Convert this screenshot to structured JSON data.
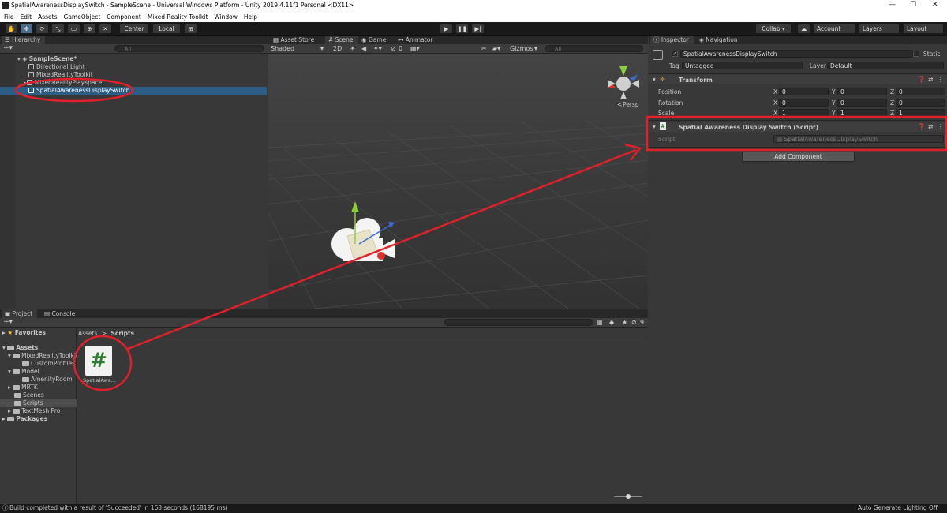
{
  "window": {
    "title": "SpatialAwarenessDisplaySwitch - SampleScene - Universal Windows Platform - Unity 2019.4.11f1 Personal <DX11>",
    "minimize": "—",
    "maximize": "☐",
    "close": "✕"
  },
  "menu": [
    "File",
    "Edit",
    "Assets",
    "GameObject",
    "Component",
    "Mixed Reality Toolkit",
    "Window",
    "Help"
  ],
  "toolbar": {
    "center": "Center",
    "local": "Local",
    "collab": "Collab ▾",
    "account": "Account",
    "layers": "Layers",
    "layout": "Layout"
  },
  "hierarchy": {
    "tab": "Hierarchy",
    "search_placeholder": "All",
    "scene": "SampleScene*",
    "items": [
      "Directional Light",
      "MixedRealityToolkit",
      "MixedRealityPlayspace",
      "SpatialAwarenessDisplaySwitch"
    ]
  },
  "scene_tabs": [
    "Asset Store",
    "Scene",
    "Game",
    "Animator"
  ],
  "scene": {
    "shading": "Shaded",
    "mode_2d": "2D",
    "fx_count": "0",
    "gizmos": "Gizmos",
    "search_placeholder": "All",
    "persp": "Persp"
  },
  "project": {
    "tabs": [
      "Project",
      "Console"
    ],
    "breadcrumb": [
      "Assets",
      "Scripts"
    ],
    "favorites": "Favorites",
    "tree": [
      {
        "label": "Assets",
        "bold": true
      },
      {
        "label": "MixedRealityToolkit.Generated",
        "bold": false
      },
      {
        "label": "CustomProfiles",
        "bold": false
      },
      {
        "label": "Model",
        "bold": false
      },
      {
        "label": "AmenityRoom",
        "bold": false
      },
      {
        "label": "MRTK",
        "bold": false
      },
      {
        "label": "Scenes",
        "bold": false
      },
      {
        "label": "Scripts",
        "bold": false
      },
      {
        "label": "TextMesh Pro",
        "bold": false
      },
      {
        "label": "Packages",
        "bold": true
      }
    ],
    "asset_label": "SpatialAwa...",
    "asset_icon": "#",
    "hidden_count": "9"
  },
  "inspector": {
    "tabs": [
      "Inspector",
      "Navigation"
    ],
    "object_name": "SpatialAwarenessDisplaySwitch",
    "static_label": "Static",
    "tag_label": "Tag",
    "tag_value": "Untagged",
    "layer_label": "Layer",
    "layer_value": "Default",
    "transform": {
      "title": "Transform",
      "rows": [
        {
          "label": "Position",
          "x": "0",
          "y": "0",
          "z": "0"
        },
        {
          "label": "Rotation",
          "x": "0",
          "y": "0",
          "z": "0"
        },
        {
          "label": "Scale",
          "x": "1",
          "y": "1",
          "z": "1"
        }
      ]
    },
    "script_component": {
      "title": "Spatial Awareness Display Switch (Script)",
      "script_label": "Script",
      "script_value": "SpatialAwarenessDisplaySwitch"
    },
    "add_component": "Add Component"
  },
  "status": {
    "message": "Build completed with a result of 'Succeeded' in 168 seconds (168195 ms)",
    "right": "Auto Generate Lighting Off"
  },
  "annotation_color": "#e0202a"
}
